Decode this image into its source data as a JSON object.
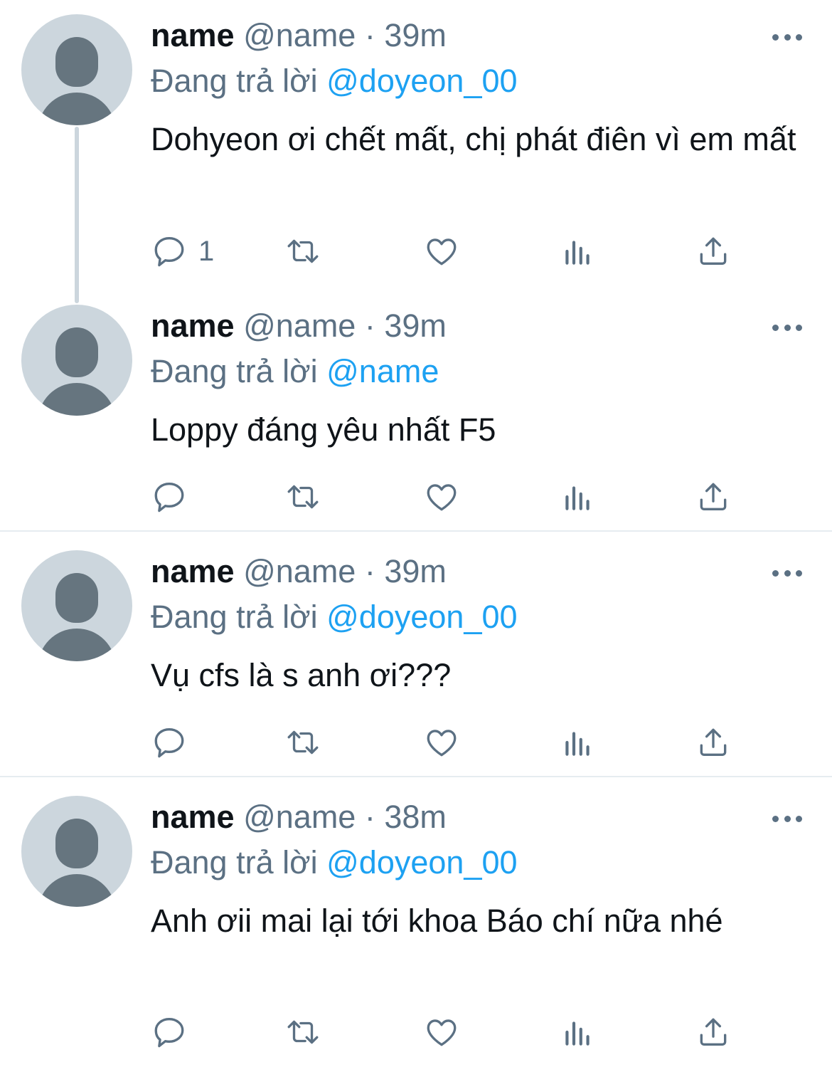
{
  "colors": {
    "text_primary": "#0f1419",
    "text_secondary": "#5b7083",
    "link": "#1da1f2",
    "avatar_bg": "#ccd6dd",
    "avatar_figure": "#66757f",
    "separator": "#e6ecf0"
  },
  "reply_prefix": "Đang trả lời",
  "tweets": [
    {
      "display_name": "name",
      "handle": "@name",
      "separator": "·",
      "time": "39m",
      "reply_to": "@doyeon_00",
      "text": "Dohyeon ơi chết mất, chị phát điên vì em mất",
      "reply_count": "1",
      "icons": [
        "more-icon",
        "reply-icon",
        "retweet-icon",
        "like-icon",
        "analytics-icon",
        "share-icon"
      ]
    },
    {
      "display_name": "name",
      "handle": "@name",
      "separator": "·",
      "time": "39m",
      "reply_to": "@name",
      "text": "Loppy đáng yêu nhất F5",
      "reply_count": "",
      "icons": [
        "more-icon",
        "reply-icon",
        "retweet-icon",
        "like-icon",
        "analytics-icon",
        "share-icon"
      ]
    },
    {
      "display_name": "name",
      "handle": "@name",
      "separator": "·",
      "time": "39m",
      "reply_to": "@doyeon_00",
      "text": "Vụ cfs là s anh ơi???",
      "reply_count": "",
      "icons": [
        "more-icon",
        "reply-icon",
        "retweet-icon",
        "like-icon",
        "analytics-icon",
        "share-icon"
      ]
    },
    {
      "display_name": "name",
      "handle": "@name",
      "separator": "·",
      "time": "38m",
      "reply_to": "@doyeon_00",
      "text": "Anh ơii mai lại tới khoa Báo chí nữa nhé",
      "reply_count": "",
      "icons": [
        "more-icon",
        "reply-icon",
        "retweet-icon",
        "like-icon",
        "analytics-icon",
        "share-icon"
      ]
    }
  ]
}
